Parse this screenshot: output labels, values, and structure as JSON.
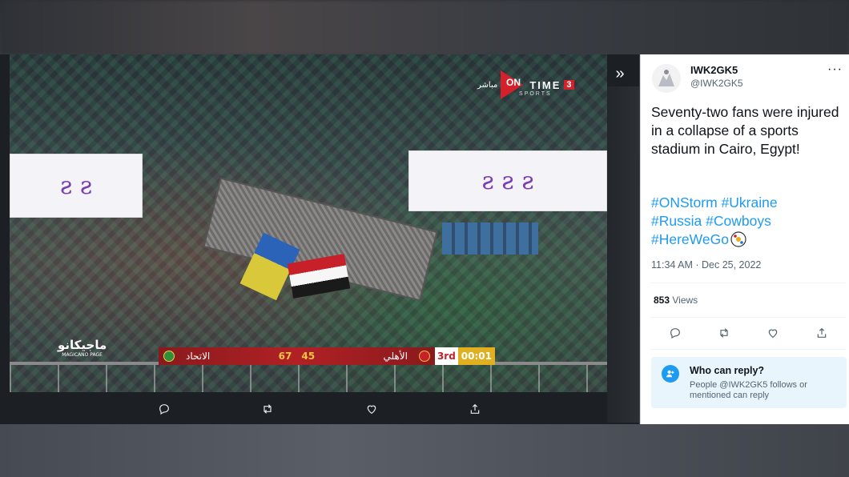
{
  "viewer": {
    "expand_label": "»",
    "prev_label": "‹"
  },
  "video": {
    "channel_logo_ar": "مباشر",
    "channel_logo_on": "ON",
    "channel_logo_time": "TIME",
    "channel_logo_num": "3",
    "channel_logo_sports": "SPORTS",
    "billboard_left": "ƨ  ƨ",
    "billboard_right": "ƨ  ƨ  ƨ",
    "watermark": "ماجيكانو",
    "watermark_sub": "MAGICANO PAGE",
    "scorebug": {
      "team_home": "الاتحاد",
      "score_home": "67",
      "score_away": "45",
      "team_away": "الأهلي",
      "period": "3rd",
      "clock": "00:01"
    }
  },
  "tweet": {
    "display_name": "IWK2GK5",
    "handle": "@IWK2GK5",
    "more": "···",
    "text": "Seventy-two fans were injured in a collapse of a sports stadium in Cairo, Egypt!",
    "hashtags": [
      "#ONStorm",
      "#Ukraine",
      "#Russia",
      "#Cowboys",
      "#HereWeGo"
    ],
    "timestamp": "11:34 AM · Dec 25, 2022",
    "views_count": "853",
    "views_label": "Views",
    "reply": {
      "title": "Who can reply?",
      "description": "People @IWK2GK5 follows or mentioned can reply"
    }
  },
  "colors": {
    "accent": "#1d9bf0",
    "scorebug_red": "#b02125",
    "scorebug_gold": "#e0b020"
  }
}
